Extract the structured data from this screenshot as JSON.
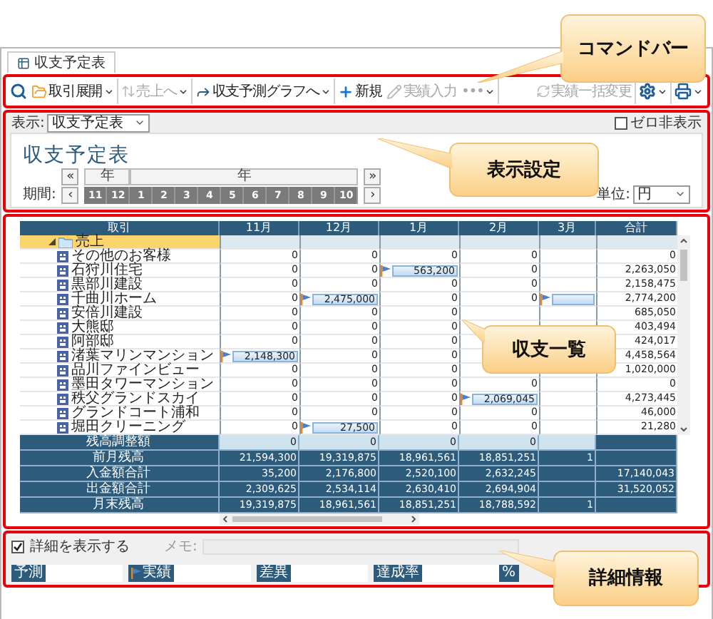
{
  "tab": {
    "label": "収支予定表"
  },
  "toolbar": {
    "left": [
      {
        "label": "取引展開",
        "disabled": false,
        "dropdown": true
      },
      {
        "label": "売上へ",
        "disabled": true,
        "dropdown": true
      },
      {
        "label": "収支予測グラフへ",
        "disabled": false,
        "dropdown": true
      },
      {
        "label": "新規",
        "disabled": false,
        "dropdown": false
      },
      {
        "label": "実績入力",
        "disabled": true,
        "dropdown": false
      },
      {
        "label": "•••",
        "disabled": true,
        "dropdown": true
      }
    ],
    "right": [
      {
        "label": "実績一括変更",
        "disabled": true,
        "dropdown": false
      }
    ]
  },
  "display": {
    "label": "表示:",
    "value": "収支予定表",
    "zero_hide": {
      "label": "ゼロ非表示",
      "checked": false
    }
  },
  "title": "収支予定表",
  "period": {
    "label": "期間:",
    "prev_year": "«",
    "next_year": "»",
    "prev": "‹",
    "next": "›",
    "years": [
      "年",
      "年"
    ],
    "months": [
      "11",
      "12",
      "1",
      "2",
      "3",
      "4",
      "5",
      "6",
      "7",
      "8",
      "9",
      "10"
    ]
  },
  "unit": {
    "label": "単位:",
    "value": "円"
  },
  "grid": {
    "columns": [
      "取引",
      "11月",
      "12月",
      "1月",
      "2月",
      "3月",
      "合計"
    ],
    "group": {
      "label": "売上",
      "expanded": true,
      "children": [
        {
          "label": "その他のお客様",
          "cells": [
            {
              "value": "0",
              "flag": false
            },
            {
              "value": "0",
              "flag": false
            },
            {
              "value": "0",
              "flag": false
            },
            {
              "value": "0",
              "flag": false
            },
            null
          ],
          "total": "0"
        },
        {
          "label": "石狩川住宅",
          "cells": [
            {
              "value": "0",
              "flag": false
            },
            {
              "value": "0",
              "flag": false
            },
            {
              "value": "563,200",
              "flag": true
            },
            {
              "value": "0",
              "flag": false
            },
            null
          ],
          "total": "2,263,050"
        },
        {
          "label": "黒部川建設",
          "cells": [
            {
              "value": "0",
              "flag": false
            },
            {
              "value": "0",
              "flag": false
            },
            {
              "value": "0",
              "flag": false
            },
            {
              "value": "0",
              "flag": false
            },
            null
          ],
          "total": "2,158,475"
        },
        {
          "label": "千曲川ホーム",
          "cells": [
            {
              "value": "0",
              "flag": false
            },
            {
              "value": "2,475,000",
              "flag": true
            },
            {
              "value": "0",
              "flag": false
            },
            {
              "value": "0",
              "flag": false
            },
            {
              "flag": true
            }
          ],
          "total": "2,774,200"
        },
        {
          "label": "安倍川建設",
          "cells": [
            {
              "value": "0",
              "flag": false
            },
            {
              "value": "0",
              "flag": false
            },
            {
              "value": "0",
              "flag": false
            },
            null,
            null
          ],
          "total": "685,050"
        },
        {
          "label": "大熊邸",
          "cells": [
            {
              "value": "0",
              "flag": false
            },
            {
              "value": "0",
              "flag": false
            },
            {
              "value": "0",
              "flag": false
            },
            null,
            null
          ],
          "total": "403,494"
        },
        {
          "label": "阿部邸",
          "cells": [
            {
              "value": "0",
              "flag": false
            },
            {
              "value": "0",
              "flag": false
            },
            {
              "value": "0",
              "flag": false
            },
            null,
            null
          ],
          "total": "424,017"
        },
        {
          "label": "渚葉マリンマンション",
          "cells": [
            {
              "value": "2,148,300",
              "flag": true
            },
            {
              "value": "0",
              "flag": false
            },
            {
              "value": "0",
              "flag": false
            },
            null,
            null
          ],
          "total": "4,458,564"
        },
        {
          "label": "品川ファインビュー",
          "cells": [
            {
              "value": "0",
              "flag": false
            },
            {
              "value": "0",
              "flag": false
            },
            {
              "value": "0",
              "flag": false
            },
            null,
            null
          ],
          "total": "1,020,000"
        },
        {
          "label": "墨田タワーマンション",
          "cells": [
            {
              "value": "0",
              "flag": false
            },
            {
              "value": "0",
              "flag": false
            },
            {
              "value": "0",
              "flag": false
            },
            {
              "value": "0",
              "flag": false
            },
            null
          ],
          "total": "0"
        },
        {
          "label": "秩父グランドスカイ",
          "cells": [
            {
              "value": "0",
              "flag": false
            },
            {
              "value": "0",
              "flag": false
            },
            {
              "value": "0",
              "flag": false
            },
            {
              "value": "2,069,045",
              "flag": true
            },
            null
          ],
          "total": "4,273,445"
        },
        {
          "label": "グランドコート浦和",
          "cells": [
            {
              "value": "0",
              "flag": false
            },
            {
              "value": "0",
              "flag": false
            },
            {
              "value": "0",
              "flag": false
            },
            {
              "value": "0",
              "flag": false
            },
            null
          ],
          "total": "46,000"
        },
        {
          "label": "堀田クリーニング",
          "cells": [
            {
              "value": "0",
              "flag": false
            },
            {
              "value": "27,500",
              "flag": true
            },
            {
              "value": "0",
              "flag": false
            },
            {
              "value": "0",
              "flag": false
            },
            null
          ],
          "total": "21,280"
        }
      ]
    },
    "summary": [
      {
        "label": "残高調整額",
        "kind": "adjust",
        "cells": [
          "0",
          "0",
          "0",
          "0",
          null
        ]
      },
      {
        "label": "前月残高",
        "kind": "balance",
        "cells": [
          "21,594,300",
          "19,319,875",
          "18,961,561",
          "18,851,251",
          "1"
        ]
      },
      {
        "label": "入金額合計",
        "kind": "balance",
        "cells": [
          "35,200",
          "2,176,800",
          "2,520,100",
          "2,632,245",
          null
        ],
        "total": "17,140,043"
      },
      {
        "label": "出金額合計",
        "kind": "balance",
        "cells": [
          "2,309,625",
          "2,534,114",
          "2,630,410",
          "2,694,904",
          null
        ],
        "total": "31,520,052"
      },
      {
        "label": "月末残高",
        "kind": "balance",
        "cells": [
          "19,319,875",
          "18,961,561",
          "18,851,251",
          "18,788,592",
          "1"
        ]
      }
    ]
  },
  "details": {
    "show": {
      "label": "詳細を表示する",
      "checked": true
    },
    "memo": {
      "label": "メモ:"
    },
    "fields": [
      {
        "label": "予測",
        "kind": "plain"
      },
      {
        "label": "実績",
        "kind": "flagged"
      },
      {
        "label": "差異",
        "kind": "plain"
      },
      {
        "label": "達成率",
        "kind": "plain",
        "suffix": "%"
      }
    ]
  },
  "callouts": [
    {
      "text": "コマンドバー"
    },
    {
      "text": "表示設定"
    },
    {
      "text": "収支一覧"
    },
    {
      "text": "詳細情報"
    }
  ]
}
